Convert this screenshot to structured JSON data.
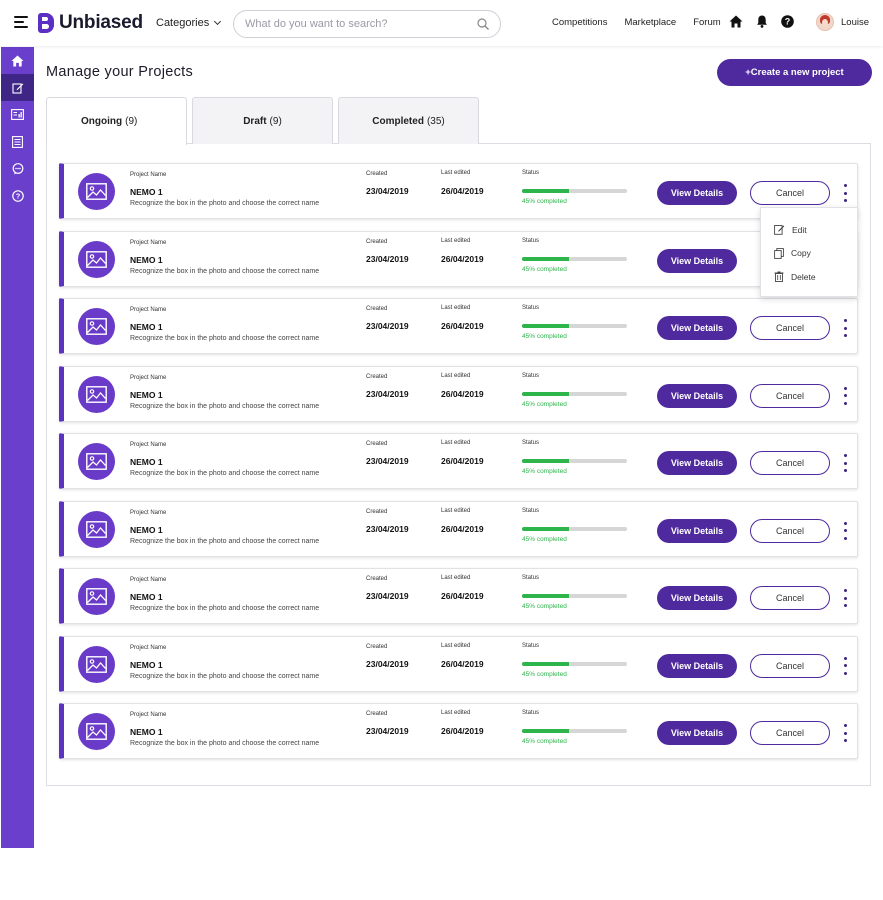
{
  "header": {
    "brand": "Unbiased",
    "categories_label": "Categories",
    "search_placeholder": "What do you want to search?",
    "nav": [
      "Competitions",
      "Marketplace",
      "Forum"
    ],
    "user_name": "Louise"
  },
  "sidebar": {
    "items": [
      "home-icon",
      "edit-icon",
      "dashboard-icon",
      "list-icon",
      "chat-icon",
      "help-icon"
    ],
    "active_index": 1
  },
  "page": {
    "title": "Manage your Projects",
    "create_label": "+Create a new project"
  },
  "tabs": [
    {
      "label": "Ongoing",
      "count": "(9)",
      "active": true
    },
    {
      "label": "Draft",
      "count": "(9)",
      "active": false
    },
    {
      "label": "Completed",
      "count": "(35)",
      "active": false
    }
  ],
  "columns": {
    "name": "Project Name",
    "created": "Created",
    "edited": "Last edited",
    "status": "Status"
  },
  "rows": [
    {
      "name": "NEMO 1",
      "description": "Recognize the box in the photo and choose the correct name",
      "created": "23/04/2019",
      "edited": "26/04/2019",
      "progress": 0.45,
      "status_text": "45% completed"
    },
    {
      "name": "NEMO 1",
      "description": "Recognize the box in the photo and choose the correct name",
      "created": "23/04/2019",
      "edited": "26/04/2019",
      "progress": 0.45,
      "status_text": "45% completed"
    },
    {
      "name": "NEMO 1",
      "description": "Recognize the box in the photo and choose the correct name",
      "created": "23/04/2019",
      "edited": "26/04/2019",
      "progress": 0.45,
      "status_text": "45% completed"
    },
    {
      "name": "NEMO 1",
      "description": "Recognize the box in the photo and choose the correct name",
      "created": "23/04/2019",
      "edited": "26/04/2019",
      "progress": 0.45,
      "status_text": "45% completed"
    },
    {
      "name": "NEMO 1",
      "description": "Recognize the box in the photo and choose the correct name",
      "created": "23/04/2019",
      "edited": "26/04/2019",
      "progress": 0.45,
      "status_text": "45% completed"
    },
    {
      "name": "NEMO 1",
      "description": "Recognize the box in the photo and choose the correct name",
      "created": "23/04/2019",
      "edited": "26/04/2019",
      "progress": 0.45,
      "status_text": "45% completed"
    },
    {
      "name": "NEMO 1",
      "description": "Recognize the box in the photo and choose the correct name",
      "created": "23/04/2019",
      "edited": "26/04/2019",
      "progress": 0.45,
      "status_text": "45% completed"
    },
    {
      "name": "NEMO 1",
      "description": "Recognize the box in the photo and choose the correct name",
      "created": "23/04/2019",
      "edited": "26/04/2019",
      "progress": 0.45,
      "status_text": "45% completed"
    },
    {
      "name": "NEMO 1",
      "description": "Recognize the box in the photo and choose the correct name",
      "created": "23/04/2019",
      "edited": "26/04/2019",
      "progress": 0.45,
      "status_text": "45% completed"
    }
  ],
  "row_actions": {
    "view_label": "View Details",
    "cancel_label": "Cancel"
  },
  "menu": {
    "open_row_index": 0,
    "items": [
      {
        "label": "Edit",
        "icon": "edit-icon"
      },
      {
        "label": "Copy",
        "icon": "copy-icon"
      },
      {
        "label": "Delete",
        "icon": "trash-icon"
      }
    ]
  },
  "colors": {
    "brand": "#4e2a9e",
    "sidebar": "#6a3fcc",
    "progress": "#2db54b"
  }
}
